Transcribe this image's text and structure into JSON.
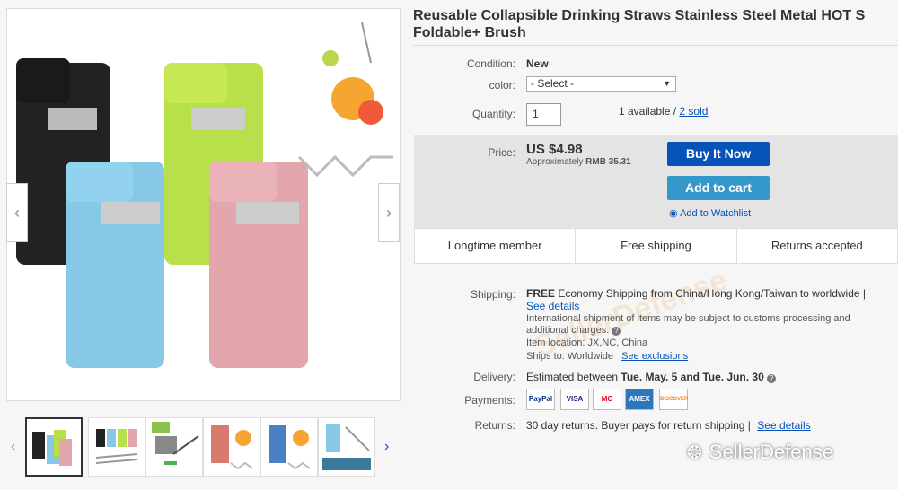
{
  "listing": {
    "title": "Reusable Collapsible Drinking Straws Stainless Steel Metal HOT S Foldable+ Brush"
  },
  "details": {
    "condition_label": "Condition:",
    "condition_value": "New",
    "color_label": "color:",
    "color_select": "- Select -",
    "quantity_label": "Quantity:",
    "quantity_value": "1",
    "available_text": "1 available /",
    "sold_text": "2 sold"
  },
  "price": {
    "label": "Price:",
    "value": "US $4.98",
    "approx_label": "Approximately",
    "approx_value": "RMB 35.31",
    "buy_now": "Buy It Now",
    "add_to_cart": "Add to cart",
    "watchlist": "Add to Watchlist"
  },
  "features": [
    "Longtime member",
    "Free shipping",
    "Returns accepted"
  ],
  "shipping": {
    "label": "Shipping:",
    "free": "FREE",
    "desc": "Economy Shipping from China/Hong Kong/Taiwan to worldwide |",
    "see_details": "See details",
    "intl_note": "International shipment of items may be subject to customs processing and additional charges.",
    "location_label": "Item location:",
    "location_value": "JX,NC, China",
    "ships_label": "Ships to:",
    "ships_value": "Worldwide",
    "exclusions": "See exclusions"
  },
  "delivery": {
    "label": "Delivery:",
    "prefix": "Estimated between",
    "dates": "Tue. May. 5 and Tue. Jun. 30"
  },
  "payments": {
    "label": "Payments:",
    "methods": [
      "PayPal",
      "VISA",
      "MC",
      "AMEX",
      "DISCOVER"
    ]
  },
  "returns": {
    "label": "Returns:",
    "text": "30 day returns. Buyer pays for return shipping |",
    "see_details": "See details"
  },
  "watermark": {
    "brand": "SellerDefense",
    "faded_text": "SellerDefense"
  },
  "colors": {
    "link": "#0654ba",
    "buy_button": "#0654ba",
    "cart_button": "#3498ca"
  }
}
